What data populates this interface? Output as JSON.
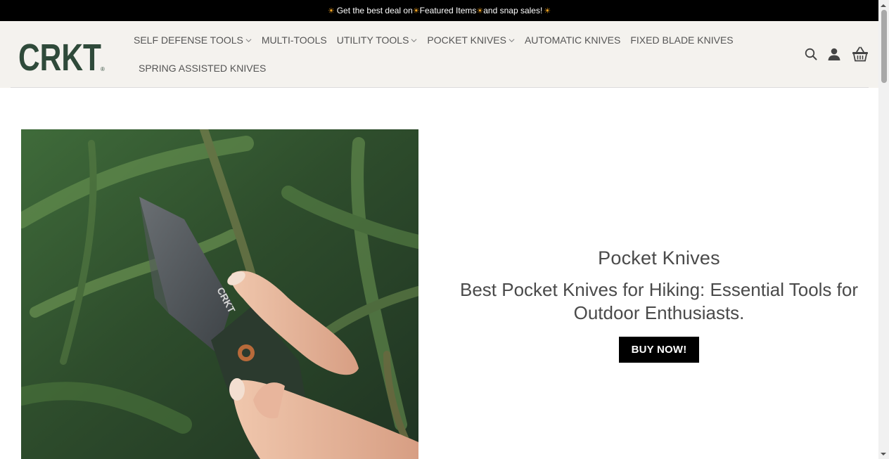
{
  "promo": {
    "part1": "Get the best deal on ",
    "part2": "Featured Items",
    "part3": " and snap sales!",
    "sun": "☀"
  },
  "brand": {
    "logo_text": "CRKT",
    "registered": "®"
  },
  "nav": {
    "row1": [
      {
        "label": "SELF DEFENSE TOOLS",
        "dropdown": true
      },
      {
        "label": "MULTI-TOOLS",
        "dropdown": false
      },
      {
        "label": "UTILITY TOOLS",
        "dropdown": true
      },
      {
        "label": "POCKET KNIVES",
        "dropdown": true
      },
      {
        "label": "AUTOMATIC KNIVES",
        "dropdown": false
      },
      {
        "label": "FIXED BLADE KNIVES",
        "dropdown": false
      }
    ],
    "row2": [
      {
        "label": "SPRING ASSISTED KNIVES",
        "dropdown": false
      }
    ]
  },
  "header_icons": [
    "search-icon",
    "account-icon",
    "basket-icon"
  ],
  "hero": {
    "category": "Pocket Knives",
    "title": "Best Pocket Knives for Hiking: Essential Tools for Outdoor Enthusiasts.",
    "button": "BUY NOW!"
  },
  "colors": {
    "topbar_bg": "#000000",
    "header_bg": "#f4f2ee",
    "logo_green": "#2f4a3a",
    "button_bg": "#000000"
  }
}
